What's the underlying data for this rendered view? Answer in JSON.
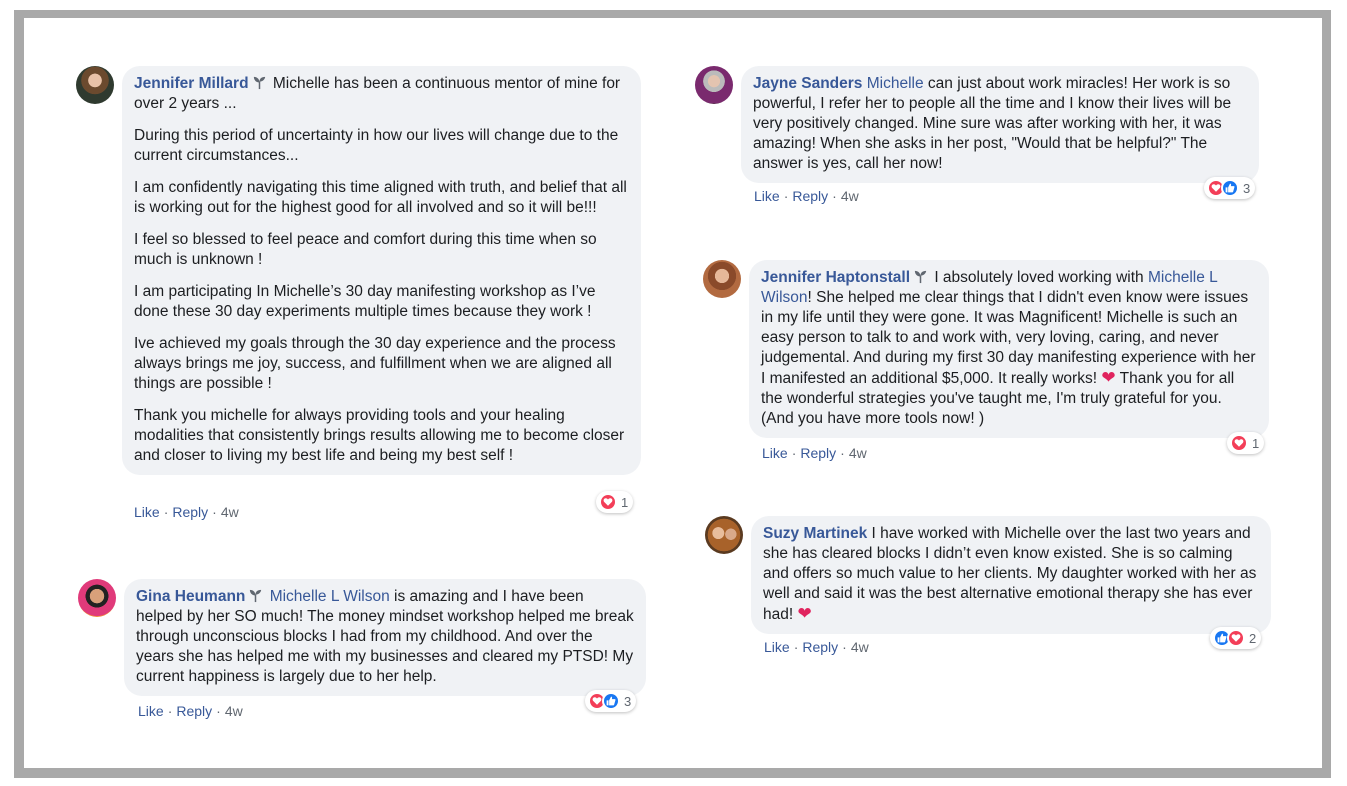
{
  "comments": [
    {
      "author": "Jennifer Millard",
      "paragraphs": [
        "Michelle has been a continuous mentor of mine for over 2 years ...",
        "During this period of uncertainty in how our lives will change due to the current circumstances...",
        "I am confidently navigating this time aligned with truth, and belief that all is working out for the highest good for all involved and so it will be!!!",
        "I feel so blessed to feel peace and comfort during this time when so much is unknown !",
        "I am participating In Michelle’s 30 day manifesting workshop as I’ve done these 30 day experiments multiple times because they work !",
        "Ive achieved my goals through the 30 day experience and the process always brings me joy, success, and fulfillment when we are aligned all things are possible !",
        "Thank you michelle for always providing tools and your healing modalities that consistently brings results allowing me to become closer and closer to living my best life and being my best self !"
      ],
      "like": "Like",
      "reply": "Reply",
      "time": "4w",
      "reactions": [
        "love"
      ],
      "reaction_count": "1"
    },
    {
      "author": "Gina Heumann",
      "mention": "Michelle L Wilson",
      "text": "is amazing and I have been helped by her SO much! The money mindset workshop helped me break through unconscious blocks I had from my childhood. And over the years she has helped me with my businesses and cleared my PTSD! My current happiness is largely due to her help.",
      "like": "Like",
      "reply": "Reply",
      "time": "4w",
      "reactions": [
        "love",
        "like"
      ],
      "reaction_count": "3"
    },
    {
      "author": "Jayne Sanders",
      "mention": "Michelle",
      "text": "can just about work miracles! Her work is so powerful, I refer her to people all the time and I know their lives will be very positively changed. Mine sure was after working with her, it was amazing! When she asks in her post, \"Would that be helpful?\" The answer is yes, call her now!",
      "like": "Like",
      "reply": "Reply",
      "time": "4w",
      "reactions": [
        "love",
        "like"
      ],
      "reaction_count": "3"
    },
    {
      "author": "Jennifer Haptonstall",
      "text_before": "I absolutely loved working with",
      "mention": "Michelle L Wilson",
      "text": "! She helped me clear things that I didn't even know were issues in my life until they were gone. It was Magnificent! Michelle is such an easy person to talk to and work with, very loving, caring, and never judgemental. And during my first 30 day manifesting experience with her I manifested an additional $5,000. It really works!",
      "emoji": "❤",
      "text_after": "Thank you for all the wonderful strategies you've taught me, I'm truly grateful for you. (And you have more tools now! )",
      "like": "Like",
      "reply": "Reply",
      "time": "4w",
      "reactions": [
        "love"
      ],
      "reaction_count": "1"
    },
    {
      "author": "Suzy Martinek",
      "text": "I have worked with Michelle over the last two years and she has cleared blocks I didn’t even know existed. She is so calming and offers so much value to her clients. My daughter worked with her as well and said it was the best alternative emotional therapy she has ever had!",
      "emoji": "❤",
      "like": "Like",
      "reply": "Reply",
      "time": "4w",
      "reactions": [
        "like",
        "love"
      ],
      "reaction_count": "2"
    }
  ],
  "colors": {
    "name": "#385898",
    "bubble": "#f0f2f5",
    "love": "#f33e58",
    "like": "#1877f2"
  }
}
